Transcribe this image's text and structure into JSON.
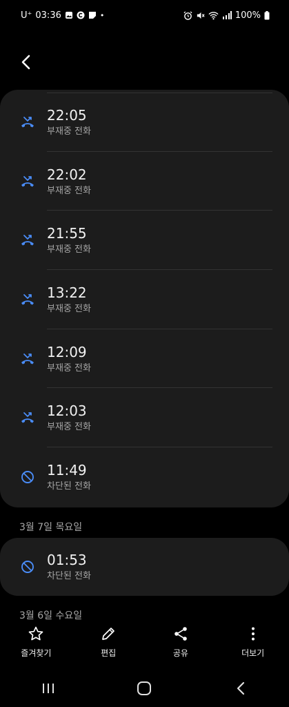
{
  "status_bar": {
    "carrier": "U⁺",
    "time": "03:36",
    "battery": "100%"
  },
  "colors": {
    "accent_blue": "#4a8cf7",
    "card_bg": "#1c1c1c",
    "divider": "#333333"
  },
  "call_log_groups": [
    {
      "entries": [
        {
          "time": "22:05",
          "type": "부재중 전화",
          "icon": "missed-call-icon"
        },
        {
          "time": "22:02",
          "type": "부재중 전화",
          "icon": "missed-call-icon"
        },
        {
          "time": "21:55",
          "type": "부재중 전화",
          "icon": "missed-call-icon"
        },
        {
          "time": "13:22",
          "type": "부재중 전화",
          "icon": "missed-call-icon"
        },
        {
          "time": "12:09",
          "type": "부재중 전화",
          "icon": "missed-call-icon"
        },
        {
          "time": "12:03",
          "type": "부재중 전화",
          "icon": "missed-call-icon"
        },
        {
          "time": "11:49",
          "type": "차단된 전화",
          "icon": "blocked-call-icon"
        }
      ]
    },
    {
      "date": "3월 7일 목요일",
      "entries": [
        {
          "time": "01:53",
          "type": "차단된 전화",
          "icon": "blocked-call-icon"
        }
      ]
    },
    {
      "date": "3월 6일 수요일",
      "entries": []
    }
  ],
  "bottom_actions": [
    {
      "label": "즐겨찾기",
      "icon": "star-icon"
    },
    {
      "label": "편집",
      "icon": "pencil-icon"
    },
    {
      "label": "공유",
      "icon": "share-icon"
    },
    {
      "label": "더보기",
      "icon": "more-vertical-icon"
    }
  ],
  "nav_bar": [
    "recents-icon",
    "home-icon",
    "back-nav-icon"
  ]
}
